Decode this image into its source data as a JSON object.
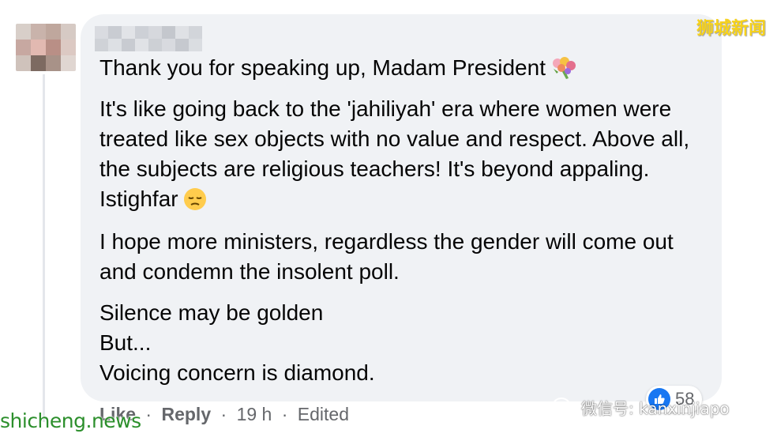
{
  "comment": {
    "paragraphs": [
      "Thank you for speaking up, Madam President",
      "It's like going back to the 'jahiliyah' era where women were treated like sex objects with no value and respect. Above all, the subjects are religious teachers! It's beyond appaling. Istighfar",
      "I hope more ministers, regardless the gender will come out and condemn the insolent poll.",
      [
        "Silence may be golden",
        "But...",
        "Voicing concern is diamond."
      ]
    ],
    "emojis": [
      "bouquet-icon",
      "pensive-face-icon"
    ]
  },
  "actions": {
    "like_label": "Like",
    "separator": "·",
    "reply_label": "Reply",
    "time": "19 h",
    "edited_label": "Edited"
  },
  "reactions": {
    "type": "like-icon",
    "count": "58",
    "color": "#1877f2"
  },
  "watermarks": {
    "top_right": "狮城新闻",
    "bottom_left": "shicheng.news",
    "wechat_label": "微信号: kanxinjiapo"
  },
  "colors": {
    "bubble": "#f0f2f5",
    "text": "#050505",
    "secondary_text": "#65676b",
    "watermark_yellow": "#f7d21a",
    "watermark_green": "#2c8f2c"
  }
}
